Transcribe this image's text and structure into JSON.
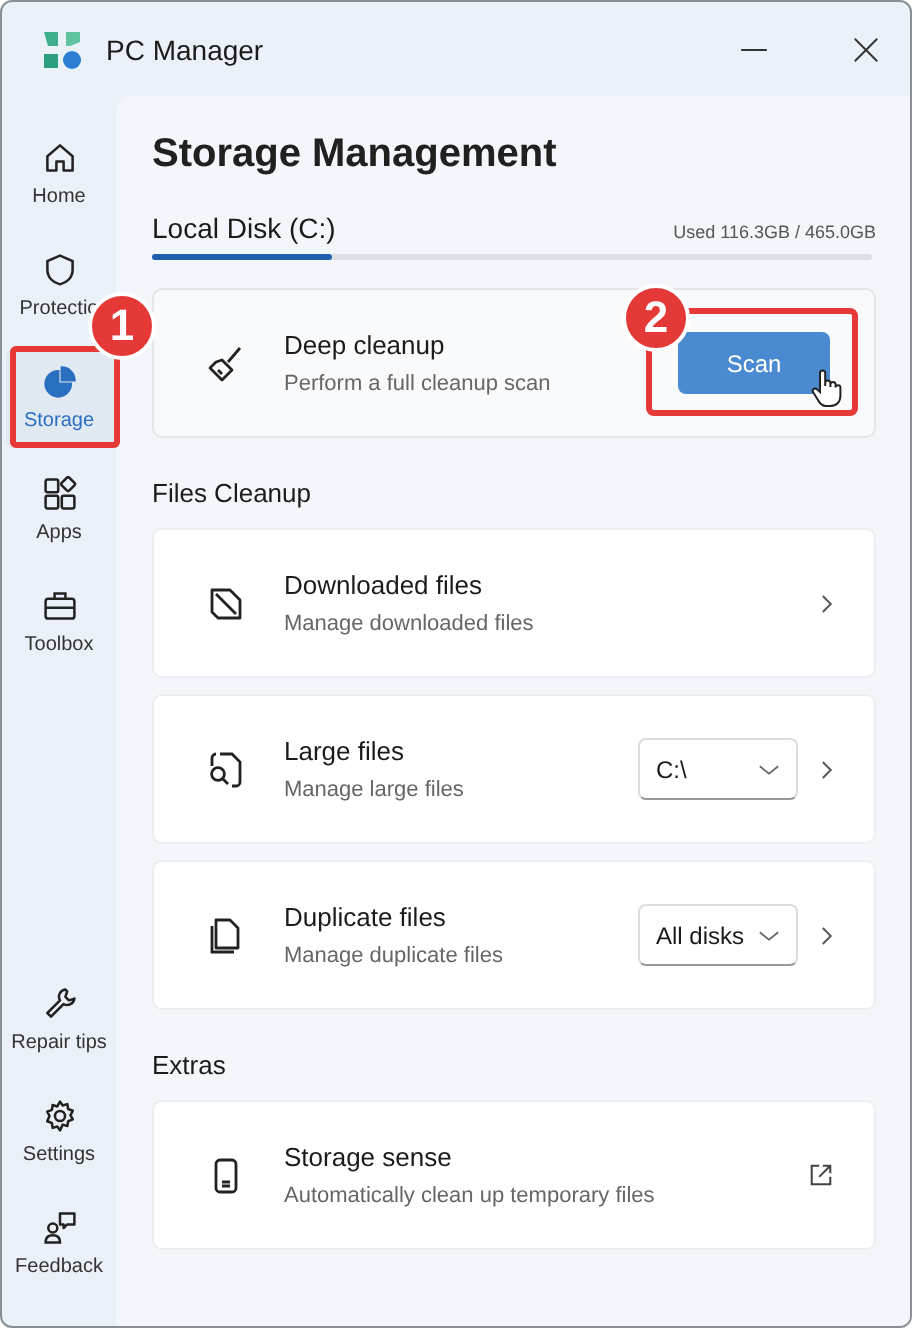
{
  "window": {
    "title": "PC Manager"
  },
  "sidebar": {
    "items": [
      {
        "label": "Home",
        "kind": "home",
        "selected": false
      },
      {
        "label": "Protectio",
        "kind": "shield",
        "selected": false
      },
      {
        "label": "Storage",
        "kind": "pie",
        "selected": true
      },
      {
        "label": "Apps",
        "kind": "apps",
        "selected": false
      },
      {
        "label": "Toolbox",
        "kind": "toolbox",
        "selected": false
      }
    ],
    "bottom_items": [
      {
        "label": "Repair tips",
        "kind": "wrench",
        "selected": false
      },
      {
        "label": "Settings",
        "kind": "gear",
        "selected": false
      },
      {
        "label": "Feedback",
        "kind": "feedback",
        "selected": false
      }
    ]
  },
  "page": {
    "title": "Storage Management"
  },
  "disk": {
    "name": "Local Disk (C:)",
    "usage": "Used 116.3GB / 465.0GB",
    "level": 0.25
  },
  "deep_cleanup": {
    "title": "Deep cleanup",
    "subtitle": "Perform a full cleanup scan",
    "button": "Scan"
  },
  "sections": [
    {
      "heading": "Files Cleanup",
      "items": [
        {
          "kind": "download",
          "title": "Downloaded files",
          "subtitle": "Manage downloaded files"
        },
        {
          "kind": "search",
          "title": "Large files",
          "subtitle": "Manage large files",
          "dropdown": "C:\\"
        },
        {
          "kind": "copy",
          "title": "Duplicate files",
          "subtitle": "Manage duplicate files",
          "dropdown": "All disks"
        }
      ]
    },
    {
      "heading": "Extras",
      "items": [
        {
          "kind": "phone",
          "title": "Storage sense",
          "subtitle": "Automatically clean up temporary files"
        }
      ]
    }
  ],
  "annotations": [
    {
      "number": "1"
    },
    {
      "number": "2"
    }
  ]
}
